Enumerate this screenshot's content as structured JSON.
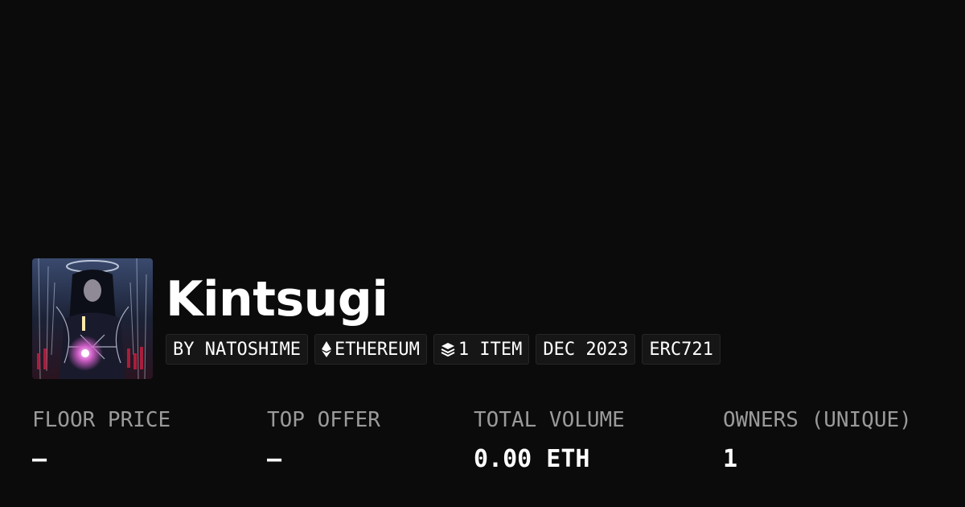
{
  "collection": {
    "title": "Kintsugi",
    "thumbnail_icon": "collection-artwork-image"
  },
  "badges": {
    "creator": "BY NATOSHIME",
    "chain": "ETHEREUM",
    "chain_icon": "ethereum-icon",
    "items": "1 ITEM",
    "items_icon": "stack-icon",
    "date": "DEC 2023",
    "standard": "ERC721"
  },
  "stats": {
    "floor_price_label": "FLOOR PRICE",
    "floor_price_value": "–",
    "top_offer_label": "TOP OFFER",
    "top_offer_value": "–",
    "total_volume_label": "TOTAL VOLUME",
    "total_volume_value": "0.00 ETH",
    "owners_label": "OWNERS (UNIQUE)",
    "owners_value": "1"
  },
  "colors": {
    "background": "#0b0b0b",
    "text": "#ffffff",
    "muted": "#9a9a9a",
    "badge_bg": "#161616"
  }
}
